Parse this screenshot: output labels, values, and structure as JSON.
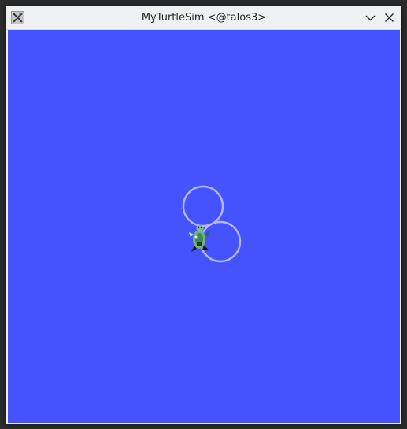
{
  "window": {
    "title": "MyTurtleSim <@talos3>",
    "app_icon": "x11-app-icon",
    "buttons": {
      "minimize_icon": "chevron-down-icon",
      "close_icon": "close-icon"
    }
  },
  "canvas": {
    "background_color": "#4553ff",
    "pen_color": "#b3b8ff",
    "turtle_icon": "turtle-sprite-icon",
    "trail_shapes": [
      "circle",
      "circle"
    ]
  }
}
